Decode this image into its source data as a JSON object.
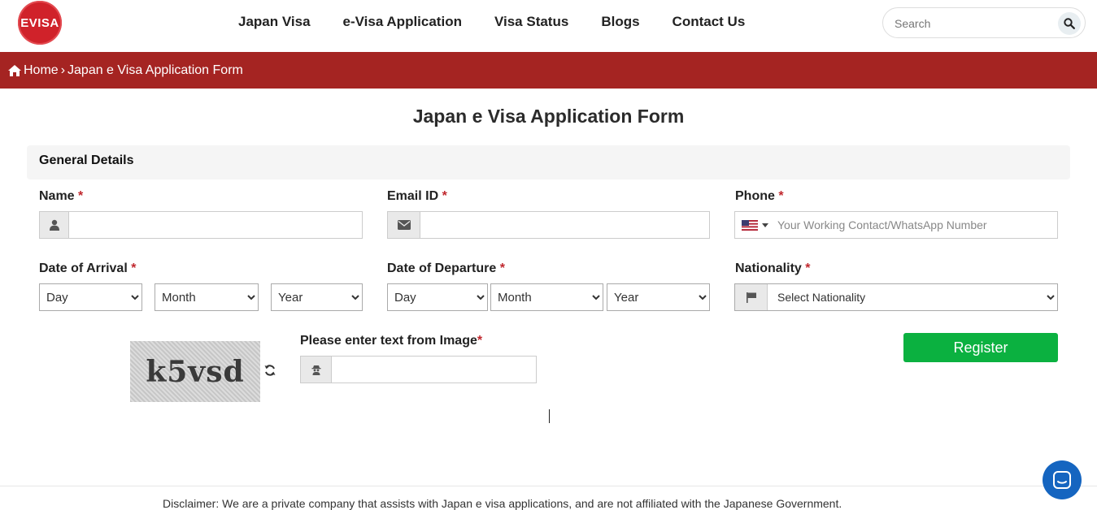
{
  "brand": {
    "logo_text": "EVISA",
    "accent": "#d0222a",
    "breadcrumb_bg": "#a52422",
    "register_bg": "#0bb140"
  },
  "nav": {
    "items": [
      "Japan Visa",
      "e-Visa Application",
      "Visa Status",
      "Blogs",
      "Contact Us"
    ]
  },
  "search": {
    "placeholder": "Search",
    "icon": "search-icon"
  },
  "breadcrumb": {
    "home": "Home",
    "separator": "›",
    "current": "Japan e Visa Application Form",
    "home_icon": "home-icon"
  },
  "page": {
    "title": "Japan e Visa Application Form"
  },
  "section": {
    "general_details": "General Details"
  },
  "form": {
    "required_mark": "*",
    "name_label": "Name",
    "email_label": "Email ID",
    "phone_label": "Phone",
    "phone_placeholder": "Your Working Contact/WhatsApp Number",
    "arrival_label": "Date of Arrival",
    "departure_label": "Date of Departure",
    "nationality_label": "Nationality",
    "day": "Day",
    "month": "Month",
    "year": "Year",
    "nationality_placeholder": "Select Nationality",
    "captcha_label": "Please enter text from Image",
    "captcha_text": "k5vsd",
    "register_label": "Register"
  },
  "footer": {
    "text": "Disclaimer: We are a private company that assists with Japan e visa applications, and are not affiliated with the Japanese Government."
  }
}
